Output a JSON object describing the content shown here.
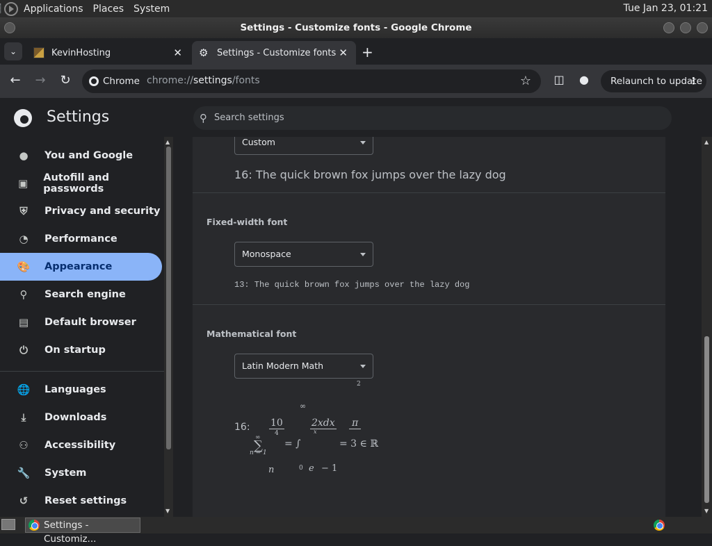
{
  "system_bar": {
    "menus": [
      "Applications",
      "Places",
      "System"
    ],
    "clock": "Tue Jan 23, 01:21"
  },
  "window": {
    "title": "Settings - Customize fonts - Google Chrome"
  },
  "tabs": [
    {
      "label": "KevinHosting",
      "active": false
    },
    {
      "label": "Settings - Customize fonts",
      "active": true
    }
  ],
  "toolbar": {
    "chip_label": "Chrome",
    "url_prefix": "chrome://",
    "url_path": "settings",
    "url_suffix": "/fonts",
    "relaunch_label": "Relaunch to update"
  },
  "settings": {
    "title": "Settings",
    "search_placeholder": "Search settings"
  },
  "sidebar": {
    "items": [
      {
        "label": "You and Google",
        "icon": "person-icon"
      },
      {
        "label": "Autofill and passwords",
        "icon": "clipboard-icon"
      },
      {
        "label": "Privacy and security",
        "icon": "shield-icon"
      },
      {
        "label": "Performance",
        "icon": "speedometer-icon"
      },
      {
        "label": "Appearance",
        "icon": "palette-icon",
        "active": true
      },
      {
        "label": "Search engine",
        "icon": "search-icon"
      },
      {
        "label": "Default browser",
        "icon": "browser-icon"
      },
      {
        "label": "On startup",
        "icon": "power-icon"
      },
      {
        "label": "Languages",
        "icon": "globe-icon"
      },
      {
        "label": "Downloads",
        "icon": "download-icon"
      },
      {
        "label": "Accessibility",
        "icon": "accessibility-icon"
      },
      {
        "label": "System",
        "icon": "wrench-icon"
      },
      {
        "label": "Reset settings",
        "icon": "history-icon"
      }
    ]
  },
  "fonts": {
    "custom": {
      "selected": "Custom",
      "preview": "16: The quick brown fox jumps over the lazy dog"
    },
    "fixed_width": {
      "heading": "Fixed-width font",
      "selected": "Monospace",
      "preview": "13: The quick brown fox jumps over the lazy dog"
    },
    "math": {
      "heading": "Mathematical font",
      "selected": "Latin Modern Math",
      "preview_prefix": "16:"
    }
  },
  "taskbar": {
    "task_label": "Settings - Customiz..."
  },
  "colors": {
    "accent": "#8ab4f8",
    "background": "#202124",
    "card": "#292a2d"
  }
}
